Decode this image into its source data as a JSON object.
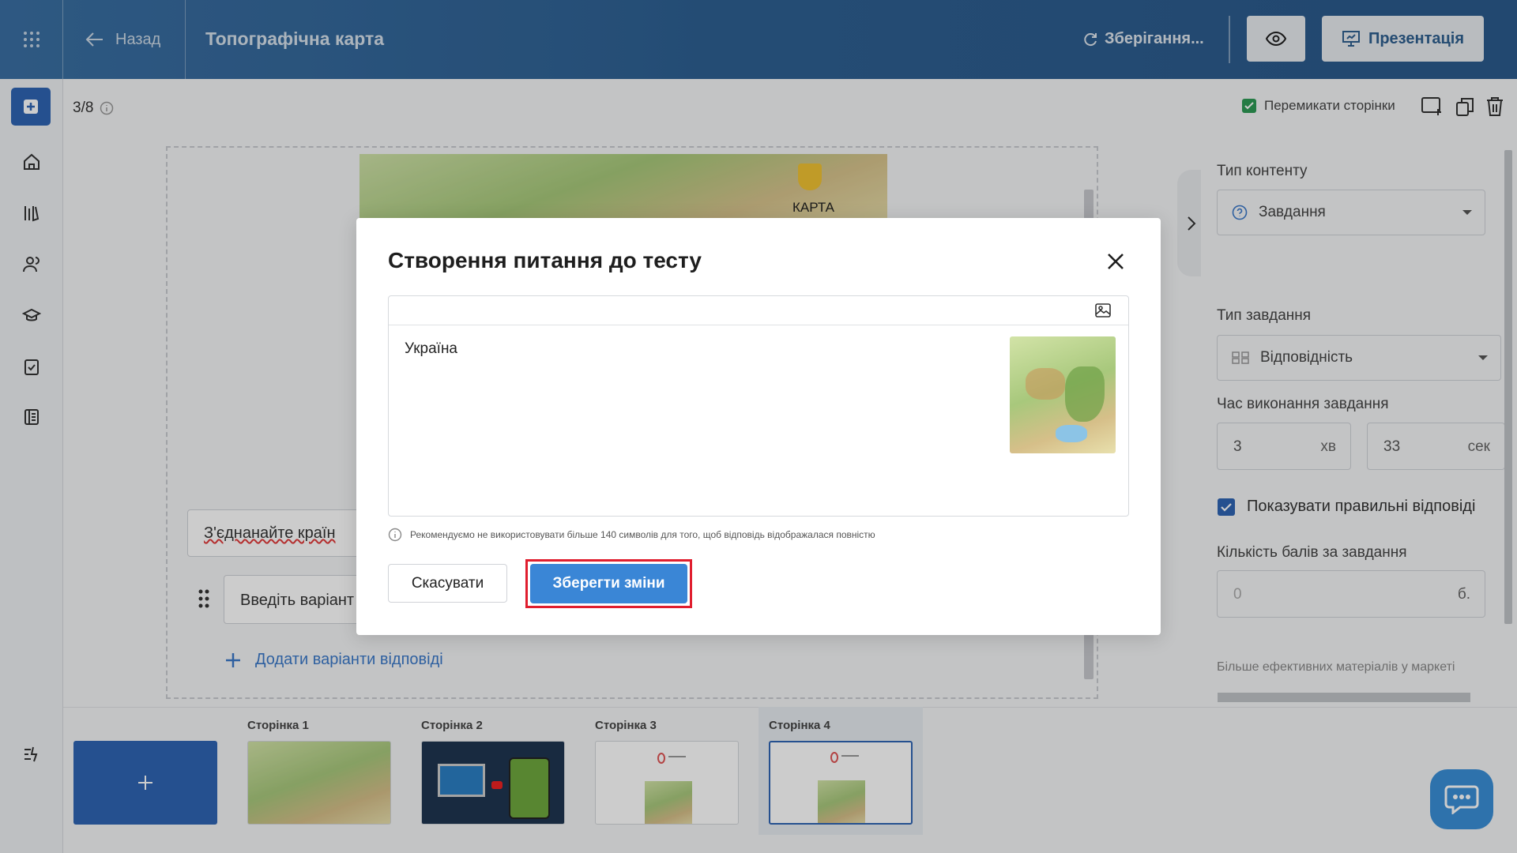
{
  "header": {
    "back_label": "Назад",
    "doc_title": "Топографічна карта",
    "saving_status": "Зберігання...",
    "present_label": "Презентація"
  },
  "toolbar": {
    "page_counter": "3/8",
    "switch_pages_label": "Перемикати сторінки"
  },
  "canvas": {
    "map_title": "КАРТА",
    "task_text": "З'єднанайте країн",
    "variant_placeholder": "Введіть варіант",
    "add_variants_label": "Додати варіанти відповіді"
  },
  "right_panel": {
    "content_type_label": "Тип контенту",
    "content_type_value": "Завдання",
    "task_type_label": "Тип завдання",
    "task_type_value": "Відповідність",
    "time_label": "Час виконання завдання",
    "minutes_value": "3",
    "minutes_unit": "хв",
    "seconds_value": "33",
    "seconds_unit": "сек",
    "show_answers_label": "Показувати правильні відповіді",
    "score_label": "Кількість балів за завдання",
    "score_value": "0",
    "score_unit": "б.",
    "market_link": "Більше ефективних матеріалів у маркеті"
  },
  "pages": [
    {
      "label": "Сторінка 1"
    },
    {
      "label": "Сторінка 2"
    },
    {
      "label": "Сторінка 3"
    },
    {
      "label": "Сторінка 4"
    }
  ],
  "modal": {
    "title": "Створення питання до тесту",
    "editor_text": "Україна",
    "hint": "Рекомендуємо не використовувати більше 140 символів для того, щоб відповідь відображалася повністю",
    "cancel_label": "Скасувати",
    "save_label": "Зберегти зміни"
  },
  "colors": {
    "header": "#2d5f91",
    "primary": "#2f64b3",
    "save_button": "#3a86d6",
    "highlight_outline": "#e01e2e",
    "checkbox_green": "#2e9a55"
  }
}
